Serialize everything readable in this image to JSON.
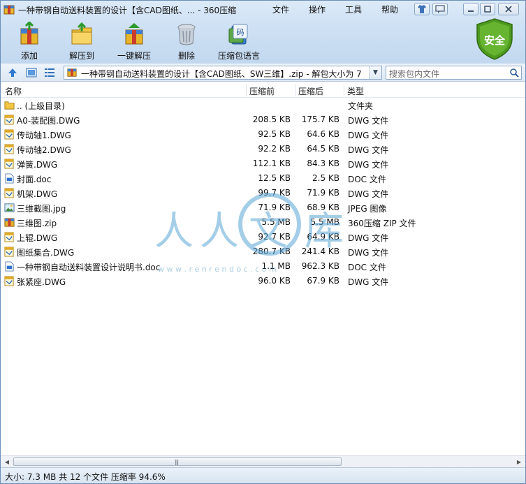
{
  "window": {
    "title": "一种带钢自动送料装置的设计【含CAD图纸、... - 360压缩",
    "menus": [
      "文件",
      "操作",
      "工具",
      "帮助"
    ]
  },
  "toolbar": {
    "add_label": "添加",
    "extract_to_label": "解压到",
    "one_click_extract_label": "一键解压",
    "delete_label": "删除",
    "comment_label": "压缩包语言"
  },
  "security_badge": {
    "label": "安全"
  },
  "address": {
    "path": "一种带钢自动送料装置的设计【含CAD图纸、SW三维】.zip - 解包大小为 7",
    "search_placeholder": "搜索包内文件"
  },
  "columns": {
    "name": "名称",
    "original_size": "压缩前",
    "packed_size": "压缩后",
    "type": "类型"
  },
  "files": [
    {
      "name": ".. (上级目录)",
      "size": "",
      "packed": "",
      "type": "文件夹",
      "icon": "folder-icon"
    },
    {
      "name": "A0-装配图.DWG",
      "size": "208.5 KB",
      "packed": "175.7 KB",
      "type": "DWG 文件",
      "icon": "dwg-file-icon"
    },
    {
      "name": "传动轴1.DWG",
      "size": "92.5 KB",
      "packed": "64.6 KB",
      "type": "DWG 文件",
      "icon": "dwg-file-icon"
    },
    {
      "name": "传动轴2.DWG",
      "size": "92.2 KB",
      "packed": "64.5 KB",
      "type": "DWG 文件",
      "icon": "dwg-file-icon"
    },
    {
      "name": "弹簧.DWG",
      "size": "112.1 KB",
      "packed": "84.3 KB",
      "type": "DWG 文件",
      "icon": "dwg-file-icon"
    },
    {
      "name": "封面.doc",
      "size": "12.5 KB",
      "packed": "2.5 KB",
      "type": "DOC 文件",
      "icon": "doc-file-icon"
    },
    {
      "name": "机架.DWG",
      "size": "99.7 KB",
      "packed": "71.9 KB",
      "type": "DWG 文件",
      "icon": "dwg-file-icon"
    },
    {
      "name": "三维截图.jpg",
      "size": "71.9 KB",
      "packed": "68.9 KB",
      "type": "JPEG 图像",
      "icon": "image-file-icon"
    },
    {
      "name": "三维图.zip",
      "size": "5.5 MB",
      "packed": "5.5 MB",
      "type": "360压缩 ZIP 文件",
      "icon": "zip-file-icon"
    },
    {
      "name": "上辊.DWG",
      "size": "92.7 KB",
      "packed": "64.9 KB",
      "type": "DWG 文件",
      "icon": "dwg-file-icon"
    },
    {
      "name": "图纸集合.DWG",
      "size": "280.7 KB",
      "packed": "241.4 KB",
      "type": "DWG 文件",
      "icon": "dwg-file-icon"
    },
    {
      "name": "一种带钢自动送料装置设计说明书.doc",
      "size": "1.1 MB",
      "packed": "962.3 KB",
      "type": "DOC 文件",
      "icon": "doc-file-icon"
    },
    {
      "name": "张紧座.DWG",
      "size": "96.0 KB",
      "packed": "67.9 KB",
      "type": "DWG 文件",
      "icon": "dwg-file-icon"
    }
  ],
  "watermark": {
    "chars": [
      "人",
      "人",
      "文",
      "库"
    ],
    "url": "w w w . r e n r e n d o c . c o m"
  },
  "status": {
    "text": "大小: 7.3 MB 共 12 个文件 压缩率 94.6%"
  },
  "colors": {
    "accent": "#2b6cb0",
    "shield": "#4e9a1f"
  }
}
